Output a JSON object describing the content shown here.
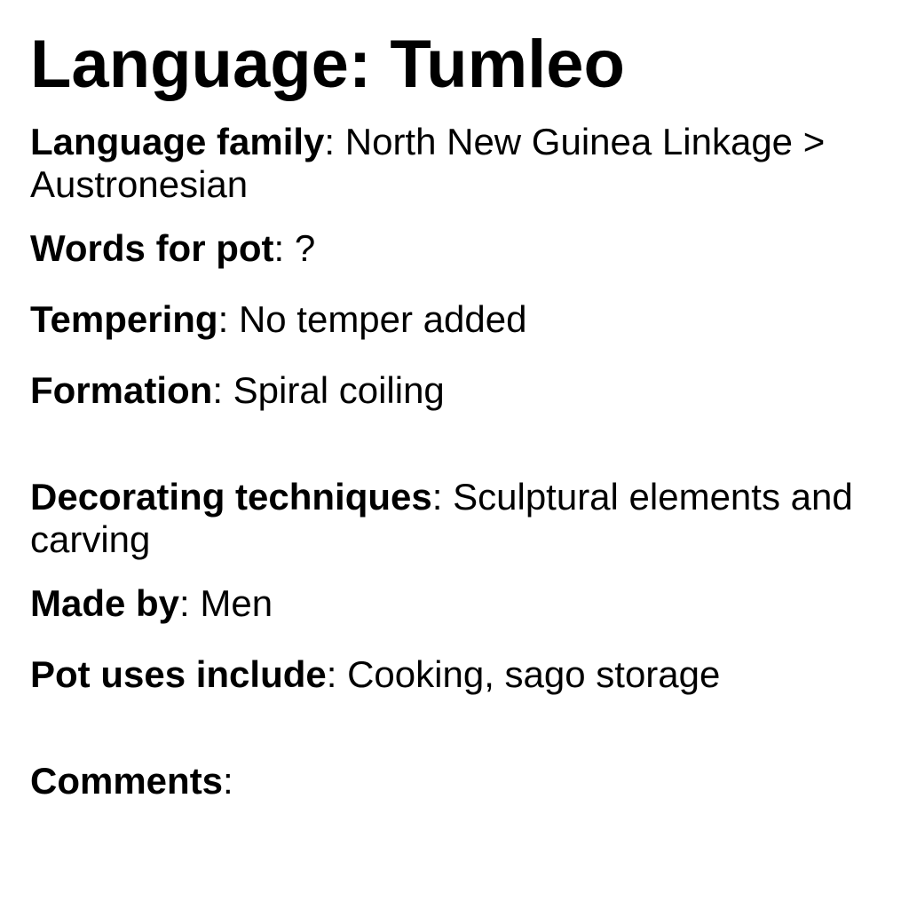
{
  "title": {
    "label": "Language",
    "value": "Tumleo"
  },
  "fields": [
    {
      "label": "Language family",
      "value": "North New Guinea Linkage > Austronesian"
    },
    {
      "label": "Words for pot",
      "value": "?"
    },
    {
      "label": "Tempering",
      "value": "No temper added"
    },
    {
      "label": "Formation",
      "value": "Spiral coiling"
    },
    {
      "label": "Decorating techniques",
      "value": "Sculptural elements and carving"
    },
    {
      "label": "Made by",
      "value": "Men"
    },
    {
      "label": "Pot uses include",
      "value": "Cooking, sago storage"
    },
    {
      "label": "Comments",
      "value": ""
    }
  ]
}
